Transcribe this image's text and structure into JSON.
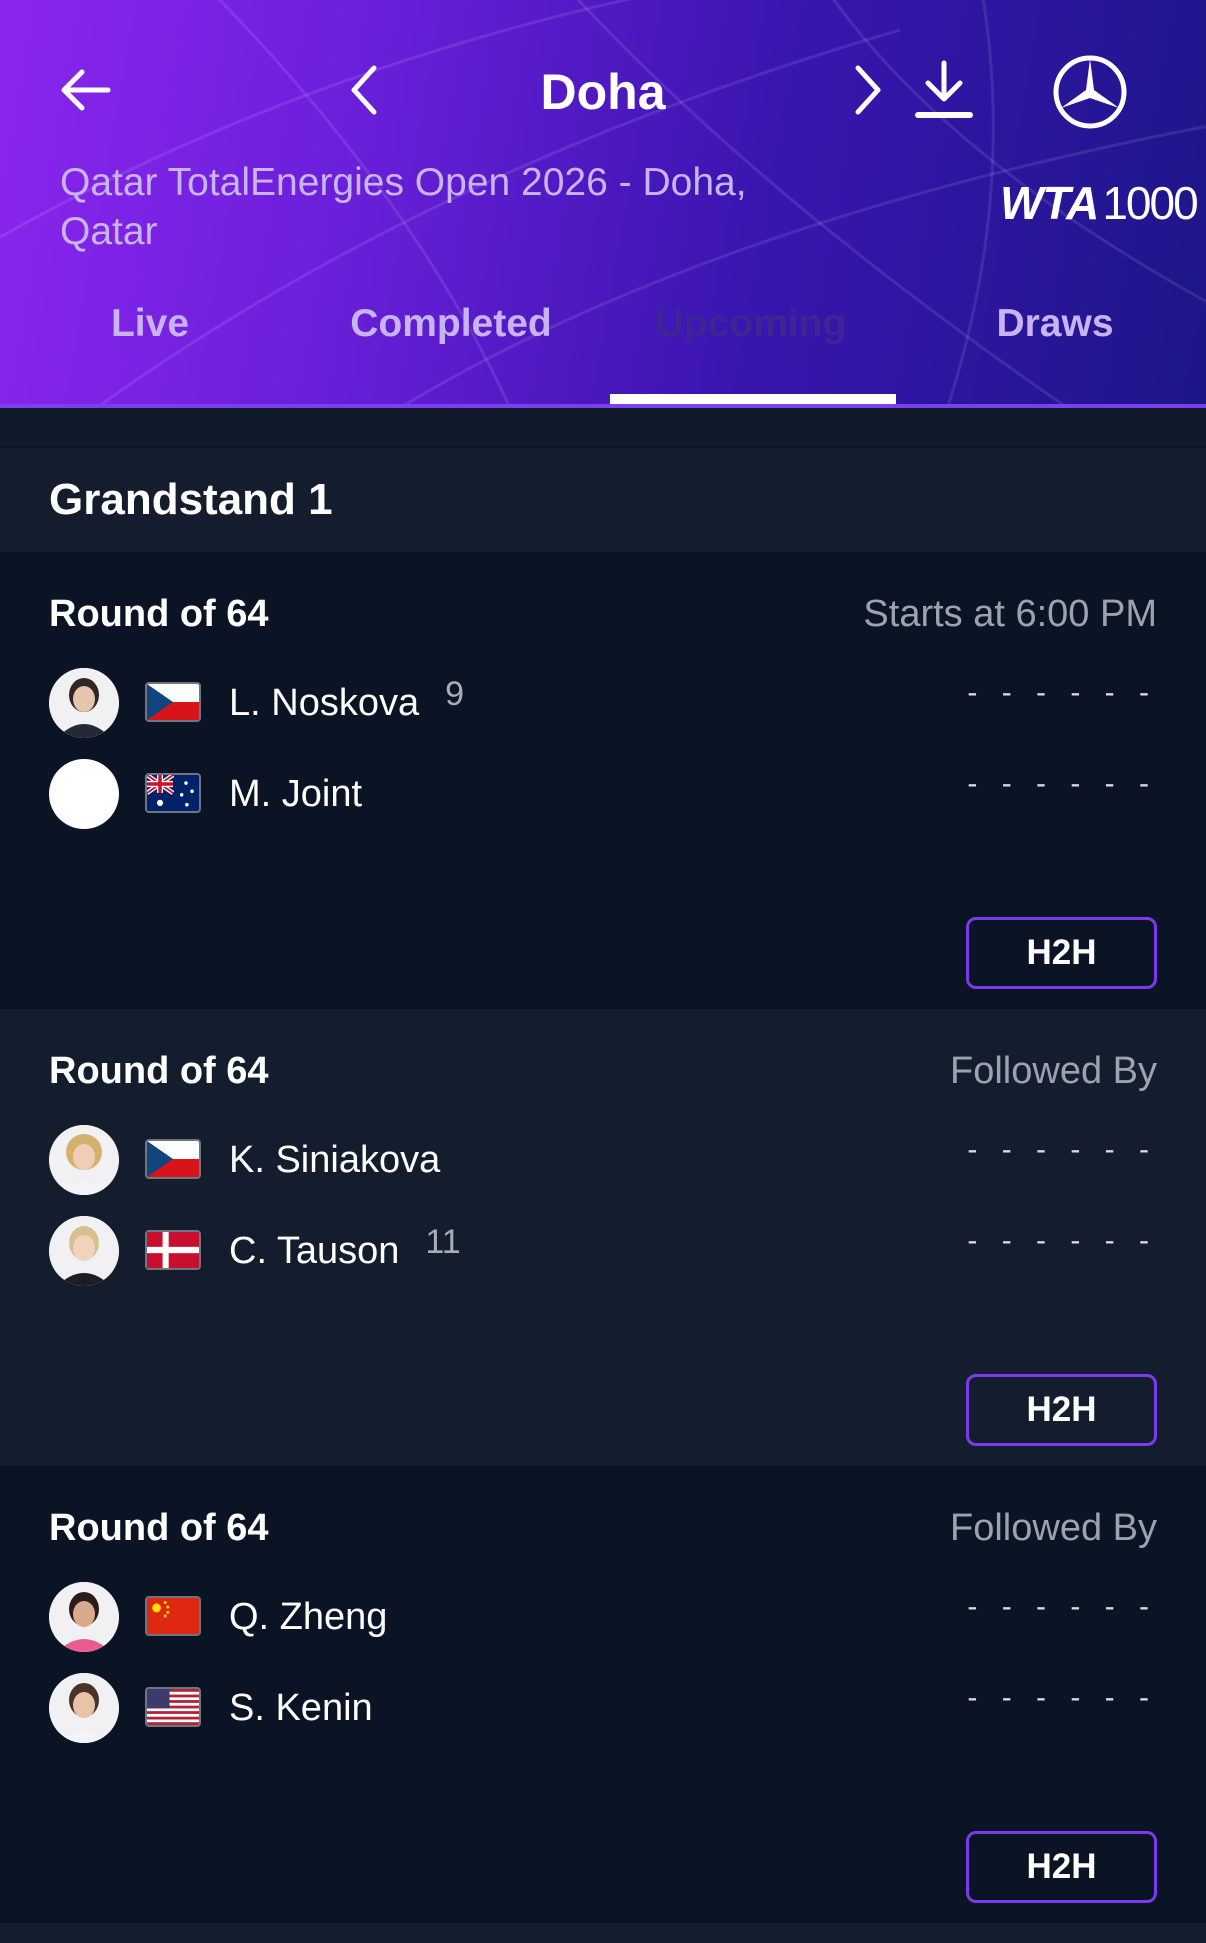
{
  "header": {
    "title": "Doha",
    "event_name": "Qatar TotalEnergies Open 2026 - Doha, Qatar",
    "logo_wta": "WTA",
    "logo_tier": "1000",
    "icons": {
      "back": "arrow-left-icon",
      "prev": "chevron-left-icon",
      "next": "chevron-right-icon",
      "download": "download-icon",
      "sponsor": "mercedes-logo"
    },
    "tabs": [
      {
        "label": "Live",
        "active": false
      },
      {
        "label": "Completed",
        "active": false
      },
      {
        "label": "Upcoming",
        "active": true
      },
      {
        "label": "Draws",
        "active": false
      }
    ]
  },
  "court": {
    "name": "Grandstand 1"
  },
  "matches": [
    {
      "round": "Round of 64",
      "status": "Starts at 6:00 PM",
      "h2h_label": "H2H",
      "players": [
        {
          "name": "L. Noskova",
          "seed": "9",
          "country": "Czech Republic",
          "flag": "flag-cz-icon",
          "avatar": "player-photo",
          "score": "- - - - - -"
        },
        {
          "name": "M. Joint",
          "seed": "",
          "country": "Australia",
          "flag": "flag-au-icon",
          "avatar": "blank-avatar",
          "score": "- - - - - -"
        }
      ]
    },
    {
      "round": "Round of 64",
      "status": "Followed By",
      "h2h_label": "H2H",
      "players": [
        {
          "name": "K. Siniakova",
          "seed": "",
          "country": "Czech Republic",
          "flag": "flag-cz-icon",
          "avatar": "player-photo",
          "score": "- - - - - -"
        },
        {
          "name": "C. Tauson",
          "seed": "11",
          "country": "Denmark",
          "flag": "flag-dk-icon",
          "avatar": "player-photo",
          "score": "- - - - - -"
        }
      ]
    },
    {
      "round": "Round of 64",
      "status": "Followed By",
      "h2h_label": "H2H",
      "players": [
        {
          "name": "Q. Zheng",
          "seed": "",
          "country": "China",
          "flag": "flag-cn-icon",
          "avatar": "player-photo",
          "score": "- - - - - -"
        },
        {
          "name": "S. Kenin",
          "seed": "",
          "country": "United States",
          "flag": "flag-us-icon",
          "avatar": "player-photo",
          "score": "- - - - - -"
        }
      ]
    }
  ],
  "colors": {
    "header_gradient_start": "#8b26ee",
    "header_gradient_end": "#1c1688",
    "accent": "#7c3aed",
    "background": "#0b1422",
    "muted_text": "#9ba3af"
  }
}
